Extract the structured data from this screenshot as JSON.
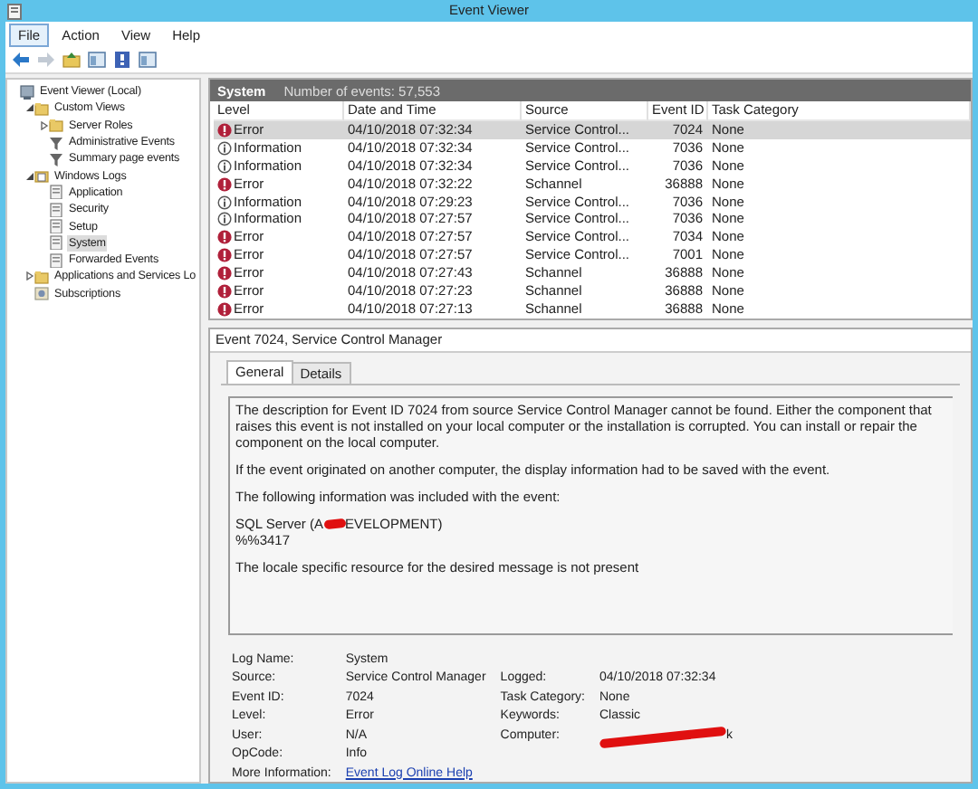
{
  "window": {
    "title": "Event Viewer"
  },
  "menu": [
    {
      "label": "File",
      "selected": true
    },
    {
      "label": "Action",
      "selected": false
    },
    {
      "label": "View",
      "selected": false
    },
    {
      "label": "Help",
      "selected": false
    }
  ],
  "toolbar": [
    {
      "kind": "back",
      "disabled": false
    },
    {
      "kind": "forward",
      "disabled": true
    },
    {
      "kind": "up",
      "disabled": false
    },
    {
      "kind": "pane",
      "disabled": false
    },
    {
      "kind": "help",
      "disabled": false
    },
    {
      "kind": "pane",
      "disabled": false
    }
  ],
  "tree": [
    {
      "label": "Event Viewer (Local)",
      "kind": "computer",
      "selected": false,
      "children": [
        {
          "label": "Custom Views",
          "kind": "folder",
          "expanded": true,
          "selected": false,
          "children": [
            {
              "label": "Server Roles",
              "kind": "folder",
              "expanded": false,
              "selected": false
            },
            {
              "label": "Administrative Events",
              "kind": "filter",
              "selected": false
            },
            {
              "label": "Summary page events",
              "kind": "filter",
              "selected": false
            }
          ]
        },
        {
          "label": "Windows Logs",
          "kind": "logs",
          "expanded": true,
          "selected": false,
          "children": [
            {
              "label": "Application",
              "kind": "log",
              "selected": false
            },
            {
              "label": "Security",
              "kind": "log",
              "selected": false
            },
            {
              "label": "Setup",
              "kind": "log",
              "selected": false
            },
            {
              "label": "System",
              "kind": "log",
              "selected": true
            },
            {
              "label": "Forwarded Events",
              "kind": "log",
              "selected": false
            }
          ]
        },
        {
          "label": "Applications and Services Lo",
          "kind": "folder",
          "expanded": false,
          "selected": false
        },
        {
          "label": "Subscriptions",
          "kind": "subs",
          "selected": false
        }
      ]
    }
  ],
  "list": {
    "name": "System",
    "count": "Number of events: 57,553",
    "columns": [
      "Level",
      "Date and Time",
      "Source",
      "Event ID",
      "Task Category"
    ],
    "rows": [
      {
        "kind": "error",
        "level": "Error",
        "date": "04/10/2018 07:32:34",
        "source": "Service Control...",
        "event_id": "7024",
        "task": "None",
        "selected": true
      },
      {
        "kind": "information",
        "level": "Information",
        "date": "04/10/2018 07:32:34",
        "source": "Service Control...",
        "event_id": "7036",
        "task": "None",
        "selected": false
      },
      {
        "kind": "information",
        "level": "Information",
        "date": "04/10/2018 07:32:34",
        "source": "Service Control...",
        "event_id": "7036",
        "task": "None",
        "selected": false
      },
      {
        "kind": "error",
        "level": "Error",
        "date": "04/10/2018 07:32:22",
        "source": "Schannel",
        "event_id": "36888",
        "task": "None",
        "selected": false
      },
      {
        "kind": "information",
        "level": "Information",
        "date": "04/10/2018 07:29:23",
        "source": "Service Control...",
        "event_id": "7036",
        "task": "None",
        "selected": false
      },
      {
        "kind": "information",
        "level": "Information",
        "date": "04/10/2018 07:27:57",
        "source": "Service Control...",
        "event_id": "7036",
        "task": "None",
        "selected": false
      },
      {
        "kind": "error",
        "level": "Error",
        "date": "04/10/2018 07:27:57",
        "source": "Service Control...",
        "event_id": "7034",
        "task": "None",
        "selected": false
      },
      {
        "kind": "error",
        "level": "Error",
        "date": "04/10/2018 07:27:57",
        "source": "Service Control...",
        "event_id": "7001",
        "task": "None",
        "selected": false
      },
      {
        "kind": "error",
        "level": "Error",
        "date": "04/10/2018 07:27:43",
        "source": "Schannel",
        "event_id": "36888",
        "task": "None",
        "selected": false
      },
      {
        "kind": "error",
        "level": "Error",
        "date": "04/10/2018 07:27:23",
        "source": "Schannel",
        "event_id": "36888",
        "task": "None",
        "selected": false
      },
      {
        "kind": "error",
        "level": "Error",
        "date": "04/10/2018 07:27:13",
        "source": "Schannel",
        "event_id": "36888",
        "task": "None",
        "selected": false
      }
    ]
  },
  "detail": {
    "title": "Event 7024, Service Control Manager",
    "tabs": [
      {
        "label": "General",
        "selected": true
      },
      {
        "label": "Details",
        "selected": false
      }
    ],
    "description": [
      {
        "kind": "text",
        "text": "The description for Event ID 7024 from source Service Control Manager cannot be found. Either the component that raises this event is not installed on your local computer or the installation is corrupted. You can install or repair the component on the local computer."
      },
      {
        "kind": "text",
        "text": "If the event originated on another computer, the display information had to be saved with the event."
      },
      {
        "kind": "text",
        "text": "The following information was included with the event:"
      },
      {
        "kind": "redacted",
        "before": "SQL Server (A",
        "after": "EVELOPMENT)",
        "next_line": "%%3417"
      },
      {
        "kind": "text",
        "text": "The locale specific resource for the desired message is not present"
      }
    ],
    "properties": [
      {
        "left": {
          "label": "Log Name:",
          "value": "System"
        }
      },
      {
        "left": {
          "label": "Source:",
          "value": "Service Control Manager"
        },
        "right": {
          "label": "Logged:",
          "value": "04/10/2018 07:32:34"
        }
      },
      {
        "left": {
          "label": "Event ID:",
          "value": "7024"
        },
        "right": {
          "label": "Task Category:",
          "value": "None"
        }
      },
      {
        "left": {
          "label": "Level:",
          "value": "Error"
        },
        "right": {
          "label": "Keywords:",
          "value": "Classic"
        }
      },
      {
        "left": {
          "label": "User:",
          "value": "N/A"
        },
        "right": {
          "label": "Computer:",
          "value": "k",
          "kind": "redacted"
        }
      },
      {
        "left": {
          "label": "OpCode:",
          "value": "Info"
        }
      },
      {
        "left": {
          "label": "More Information:",
          "value": "Event Log Online Help",
          "kind": "link"
        }
      }
    ]
  }
}
